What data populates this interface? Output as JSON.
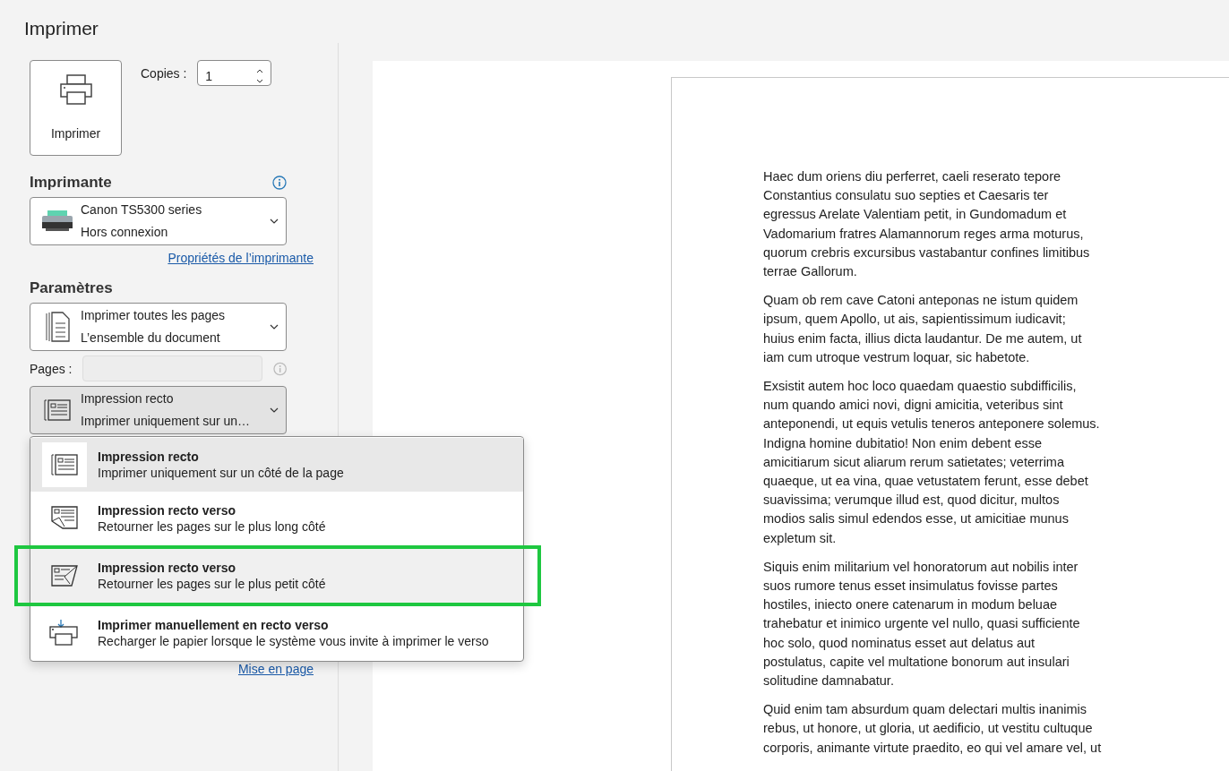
{
  "title": "Imprimer",
  "print_button": {
    "label": "Imprimer"
  },
  "copies": {
    "label": "Copies :",
    "value": "1"
  },
  "printer": {
    "heading": "Imprimante",
    "name": "Canon TS5300 series",
    "status": "Hors connexion",
    "properties_link": "Propriétés de l’imprimante"
  },
  "settings": {
    "heading": "Paramètres",
    "range": {
      "title": "Imprimer toutes les pages",
      "subtitle": "L’ensemble du document"
    },
    "pages": {
      "label": "Pages :",
      "disabled": true
    },
    "sides": {
      "title": "Impression recto",
      "subtitle": "Imprimer uniquement sur un…",
      "expanded": true
    },
    "sides_menu": [
      {
        "kind": "single",
        "title": "Impression recto",
        "subtitle": "Imprimer uniquement sur un côté de la page",
        "selected": true,
        "highlighted": false
      },
      {
        "kind": "long",
        "title": "Impression recto verso",
        "subtitle": "Retourner les pages sur le plus long côté",
        "selected": false,
        "highlighted": false
      },
      {
        "kind": "short",
        "title": "Impression recto verso",
        "subtitle": "Retourner les pages sur le plus petit côté",
        "selected": false,
        "highlighted": true
      },
      {
        "kind": "manual",
        "title": "Imprimer manuellement en recto verso",
        "subtitle": "Recharger le papier lorsque le système vous invite à imprimer le verso",
        "selected": false,
        "highlighted": false
      }
    ],
    "page_setup_link": "Mise en page"
  },
  "preview": {
    "paragraphs": [
      {
        "lines": [
          "Haec dum oriens diu perferret, caeli reserato tepore",
          "Constantius consulatu suo septies et Caesaris ter",
          "egressus Arelate Valentiam petit, in Gundomadum et",
          "Vadomarium fratres Alamannorum reges arma moturus,",
          "quorum crebris excursibus vastabantur confines limitibus",
          "terrae Gallorum."
        ]
      },
      {
        "lines": [
          "Quam ob rem cave Catoni anteponas ne istum quidem",
          "ipsum, quem Apollo, ut ais, sapientissimum iudicavit;",
          "huius enim facta, illius dicta laudantur. De me autem, ut",
          "iam cum utroque vestrum loquar, sic habetote."
        ]
      },
      {
        "lines": [
          "Exsistit autem hoc loco quaedam quaestio subdifficilis,",
          "num quando amici novi, digni amicitia, veteribus sint",
          "anteponendi, ut equis vetulis teneros anteponere solemus.",
          "Indigna homine dubitatio! Non enim debent esse",
          "amicitiarum sicut aliarum rerum satietates; veterrima",
          "quaeque, ut ea vina, quae vetustatem ferunt, esse debet",
          "suavissima; verumque illud est, quod dicitur, multos",
          "modios salis simul edendos esse, ut amicitiae munus",
          "expletum sit."
        ]
      },
      {
        "lines": [
          "Siquis enim militarium vel honoratorum aut nobilis inter",
          "suos rumore tenus esset insimulatus fovisse partes",
          "hostiles, iniecto onere catenarum in modum beluae",
          "trahebatur et inimico urgente vel nullo, quasi sufficiente",
          "hoc solo, quod nominatus esset aut delatus aut",
          "postulatus, capite vel multatione bonorum aut insulari",
          "solitudine damnabatur."
        ]
      },
      {
        "lines": [
          "Quid enim tam absurdum quam delectari multis inanimis",
          "rebus, ut honore, ut gloria, ut aedificio, ut vestitu cultuque",
          "corporis, animante virtute praedito, eo qui vel amare vel, ut"
        ]
      }
    ]
  }
}
